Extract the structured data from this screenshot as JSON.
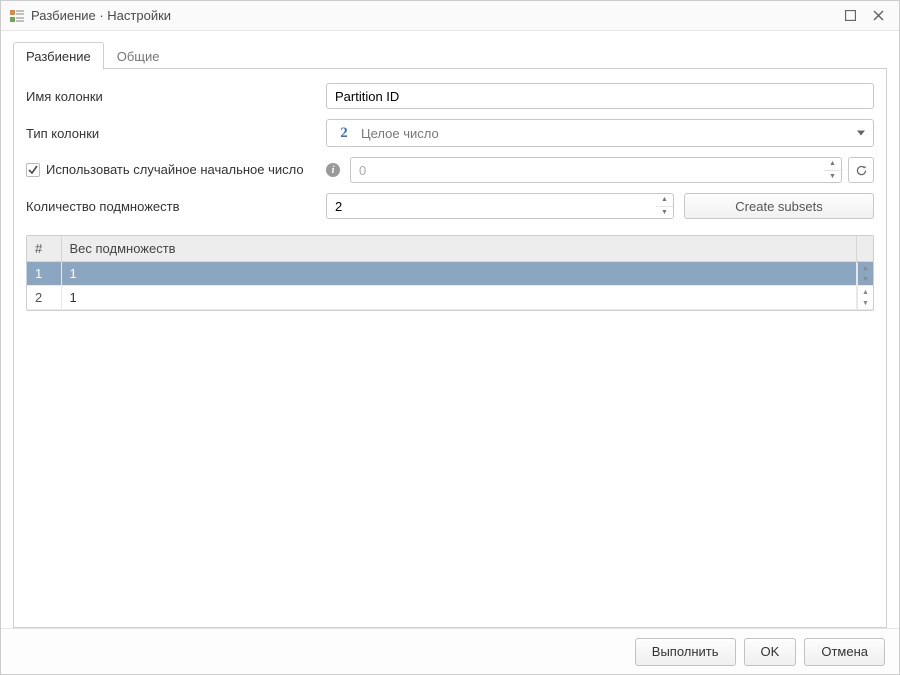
{
  "window": {
    "title": "Разбиение · Настройки"
  },
  "tabs": {
    "partition": "Разбиение",
    "general": "Общие"
  },
  "form": {
    "column_name_label": "Имя колонки",
    "column_name_value": "Partition ID",
    "column_type_label": "Тип колонки",
    "column_type_value": "Целое число",
    "type_icon_glyph": "2",
    "use_random_seed_label": "Использовать случайное начальное число",
    "use_random_seed_checked": true,
    "seed_value": "0",
    "subset_count_label": "Количество подмножеств",
    "subset_count_value": "2",
    "create_subsets_label": "Create subsets"
  },
  "table": {
    "col_index": "#",
    "col_weight": "Вес подмножеств",
    "rows": [
      {
        "idx": "1",
        "weight": "1",
        "selected": true
      },
      {
        "idx": "2",
        "weight": "1",
        "selected": false
      }
    ]
  },
  "footer": {
    "execute": "Выполнить",
    "ok": "OK",
    "cancel": "Отмена"
  }
}
